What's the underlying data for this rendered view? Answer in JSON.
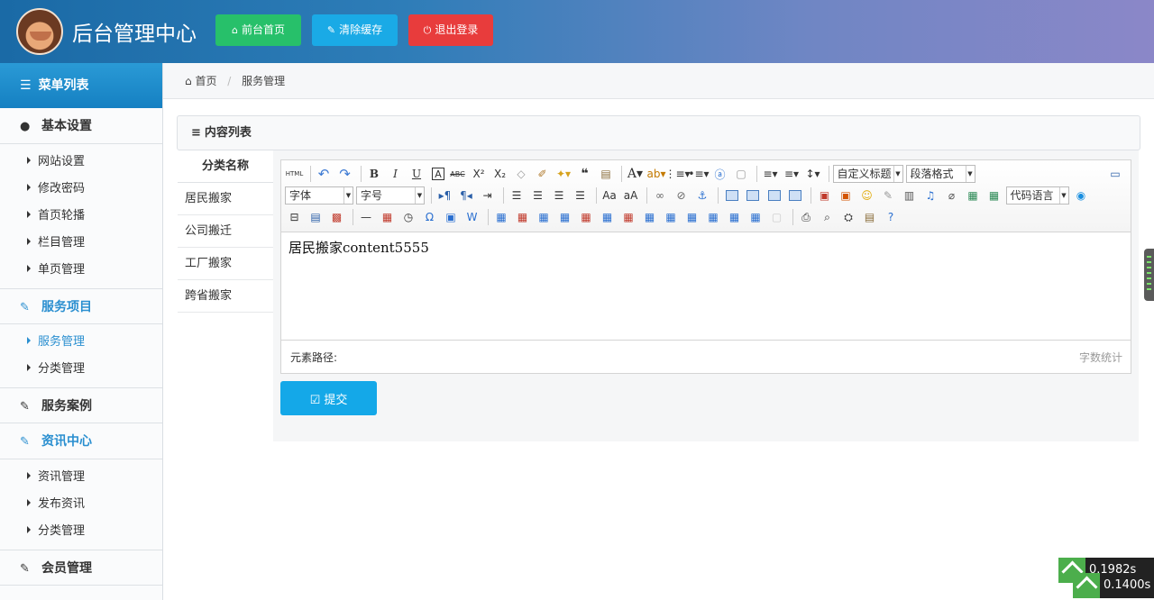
{
  "header": {
    "title": "后台管理中心",
    "buttons": [
      {
        "label": "前台首页",
        "icon": "home-icon",
        "color": "#27c06a"
      },
      {
        "label": "清除缓存",
        "icon": "wrench-icon",
        "color": "#1aaae6"
      },
      {
        "label": "退出登录",
        "icon": "power-icon",
        "color": "#e83c3c"
      }
    ]
  },
  "sidebar": {
    "title": "菜单列表",
    "groups": [
      {
        "label": "基本设置",
        "icon": "user-icon",
        "items": [
          "网站设置",
          "修改密码",
          "首页轮播",
          "栏目管理",
          "单页管理"
        ]
      },
      {
        "label": "服务项目",
        "icon": "edit-icon",
        "items": [
          "服务管理",
          "分类管理"
        ]
      },
      {
        "label": "服务案例",
        "icon": "edit-icon",
        "items": []
      },
      {
        "label": "资讯中心",
        "icon": "edit-icon",
        "items": [
          "资讯管理",
          "发布资讯",
          "分类管理"
        ]
      },
      {
        "label": "会员管理",
        "icon": "edit-icon",
        "items": []
      }
    ]
  },
  "breadcrumb": {
    "home": "首页",
    "current": "服务管理"
  },
  "panel": {
    "title": "内容列表"
  },
  "categories": {
    "header": "分类名称",
    "items": [
      "居民搬家",
      "公司搬迁",
      "工厂搬家",
      "跨省搬家"
    ]
  },
  "editor": {
    "font_dropdown": "字体",
    "size_dropdown": "字号",
    "custom_title_dropdown": "自定义标题",
    "paragraph_dropdown": "段落格式",
    "code_lang_dropdown": "代码语言",
    "content": "居民搬家content5555",
    "element_path": "元素路径:",
    "word_count": "字数统计",
    "html_label": "HTML"
  },
  "submit": {
    "label": "提交"
  },
  "timers": [
    "0.1982s",
    "0.1400s"
  ]
}
